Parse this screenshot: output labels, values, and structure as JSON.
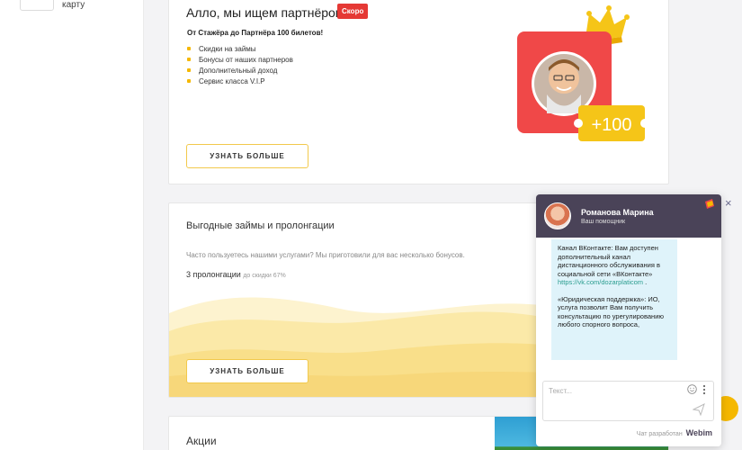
{
  "sidebar": {
    "item_text": "карту"
  },
  "partners": {
    "title": "Алло, мы ищем партнёров!",
    "badge": "Скоро",
    "subtitle": "От Стажёра до Партнёра 100 билетов!",
    "bullets": [
      "Скидки на займы",
      "Бонусы от наших партнеров",
      "Дополнительный доход",
      "Сервис класса V.I.P"
    ],
    "button": "УЗНАТЬ БОЛЬШЕ",
    "promo_value": "+100"
  },
  "loans": {
    "title": "Выгодные займы и пролонгации",
    "description": "Часто пользуетесь нашими услугами? Мы приготовили для вас несколько бонусов.",
    "prolongation": "3 пролонгации",
    "discount": "до скидки 67%",
    "button": "УЗНАТЬ БОЛЬШЕ"
  },
  "promotions": {
    "title": "Акции"
  },
  "chat": {
    "operator_name": "Романова Марина",
    "operator_role": "Ваш помощник",
    "message_part1": " Канал ВКонтакте: Вам доступен дополнительный канал дистанционного обслуживания в социальной сети «ВКонтакте»",
    "message_link": "https://vk.com/dozarplaticom",
    "message_link_tail": " .",
    "message_part2": " «Юридическая поддержка»: ИО, услуга позволит Вам получить консультацию по урегулированию любого спорного вопроса,",
    "input_placeholder": "Текст...",
    "footer_text": "Чат разработан",
    "footer_brand": "Webim",
    "close_label": "×"
  },
  "colors": {
    "accent_yellow": "#f5b800",
    "badge_red": "#e53935",
    "chat_header": "#4a4358",
    "bubble_bg": "#dff3fa"
  },
  "icons": [
    "crown-icon",
    "smile-icon",
    "more-dots-icon",
    "send-icon",
    "close-icon",
    "chat-logo-icon"
  ]
}
